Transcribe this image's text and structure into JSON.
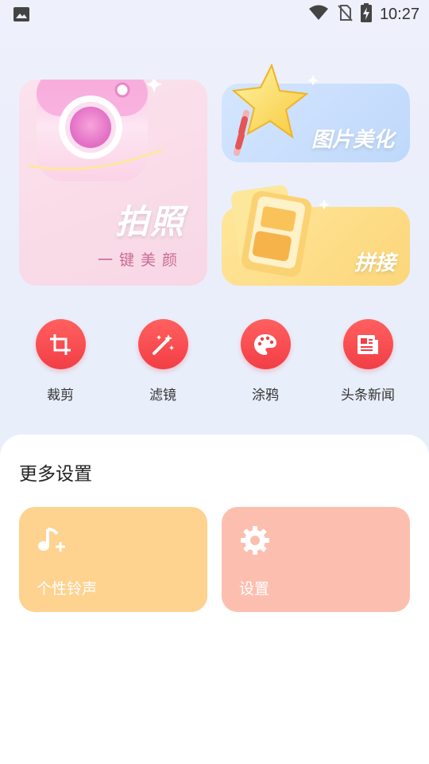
{
  "status_bar": {
    "time": "10:27",
    "icons": [
      "image-icon",
      "wifi-icon",
      "no-sim-icon",
      "battery-charging-icon"
    ]
  },
  "cards": {
    "photo": {
      "title": "拍照",
      "subtitle": "一键美颜",
      "icon": "camera-icon"
    },
    "beautify": {
      "title": "图片美化",
      "icon": "star-wand-icon"
    },
    "collage": {
      "title": "拼接",
      "icon": "photo-stack-icon"
    }
  },
  "tools": [
    {
      "label": "裁剪",
      "icon": "crop-icon"
    },
    {
      "label": "滤镜",
      "icon": "magic-wand-icon"
    },
    {
      "label": "涂鸦",
      "icon": "palette-icon"
    },
    {
      "label": "头条新闻",
      "icon": "newspaper-icon"
    }
  ],
  "more_settings": {
    "title": "更多设置",
    "items": [
      {
        "label": "个性铃声",
        "icon": "music-note-add-icon",
        "color": "#fed28f"
      },
      {
        "label": "设置",
        "icon": "gear-icon",
        "color": "#fcbfaf"
      }
    ]
  },
  "colors": {
    "accent_red": "#f23e46",
    "photo_card": "#f8d7e5",
    "beautify_card": "#c8ddfb",
    "collage_card": "#fddb82"
  }
}
